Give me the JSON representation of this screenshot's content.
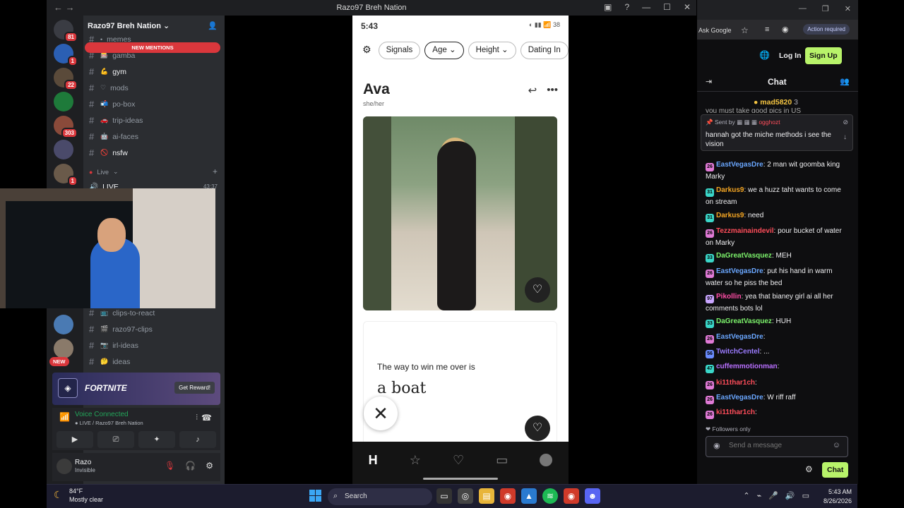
{
  "discord": {
    "window_title": "Razo97 Breh Nation",
    "server_name": "Razo97 Breh Nation",
    "new_mentions": "NEW MENTIONS",
    "badges": [
      "81",
      "1",
      "22",
      "303",
      "1",
      "NEW"
    ],
    "channels": [
      {
        "name": "memes",
        "emoji": "•",
        "bold": false
      },
      {
        "name": "gamba",
        "emoji": "🎰",
        "bold": false
      },
      {
        "name": "gym",
        "emoji": "💪",
        "bold": true
      },
      {
        "name": "mods",
        "emoji": "♡",
        "bold": false
      },
      {
        "name": "po-box",
        "emoji": "📬",
        "bold": false
      },
      {
        "name": "trip-ideas",
        "emoji": "🚗",
        "bold": false
      },
      {
        "name": "ai-faces",
        "emoji": "🤖",
        "bold": false
      },
      {
        "name": "nsfw",
        "emoji": "🚫",
        "bold": true
      }
    ],
    "live_category": "Live",
    "live_channel": "LIVE",
    "live_time": "43:37",
    "channels_lower": [
      {
        "name": "clips-to-react",
        "emoji": "📺"
      },
      {
        "name": "razo97-clips",
        "emoji": "🎬"
      },
      {
        "name": "irl-ideas",
        "emoji": "📷"
      },
      {
        "name": "ideas",
        "emoji": "🤔"
      }
    ],
    "promo": {
      "name": "FORTNITE",
      "button": "Get Reward!"
    },
    "voice": {
      "status": "Voice Connected",
      "channel": "LIVE / Razo97 Breh Nation"
    },
    "user": {
      "name": "Razo",
      "status": "Invisible"
    }
  },
  "phone": {
    "time": "5:43",
    "battery": "38",
    "filters": [
      "Signals",
      "Age",
      "Height",
      "Dating In"
    ],
    "profile_name": "Ava",
    "pronouns": "she/her",
    "prompt_question": "The way to win me over is",
    "prompt_answer": "a boat"
  },
  "browser": {
    "ask_google": "Ask Google",
    "action_required": "Action required",
    "login": "Log In",
    "signup": "Sign Up",
    "chat_title": "Chat",
    "pinned_sender": "ogghozt",
    "pinned_label": "Sent by",
    "pinned_text": "hannah got the miche methods i see the vision",
    "top_user": "mad5820",
    "top_user_count": "3",
    "top_cut_text": "you must take good pics in US",
    "messages": [
      {
        "badge": "26",
        "badgecolor": "#e07ad6",
        "user": "EastVegasDre",
        "color": "#6aa7ff",
        "text": ": 2 man wit goomba king Marky"
      },
      {
        "badge": "31",
        "badgecolor": "#3ad6c8",
        "user": "Darkus9",
        "color": "#f5a623",
        "text": ": we a huzz taht wants to come on stream"
      },
      {
        "badge": "31",
        "badgecolor": "#3ad6c8",
        "user": "Darkus9",
        "color": "#f5a623",
        "text": ": need"
      },
      {
        "badge": "26",
        "badgecolor": "#e07ad6",
        "user": "Tezzmainaindevil",
        "color": "#ff4d5a",
        "text": ": pour bucket of water on Marky"
      },
      {
        "badge": "33",
        "badgecolor": "#3ad6c8",
        "user": "DaGreatVasquez",
        "color": "#7cf26b",
        "text": ": MEH"
      },
      {
        "badge": "26",
        "badgecolor": "#e07ad6",
        "user": "EastVegasDre",
        "color": "#6aa7ff",
        "text": ": put his hand in warm water so he piss the bed"
      },
      {
        "badge": "97",
        "badgecolor": "#c9a6ff",
        "user": "Pikollin",
        "color": "#ff4da6",
        "text": ": yea that bianey girl ai all her comments bots lol"
      },
      {
        "badge": "33",
        "badgecolor": "#3ad6c8",
        "user": "DaGreatVasquez",
        "color": "#7cf26b",
        "text": ": HUH"
      },
      {
        "badge": "26",
        "badgecolor": "#e07ad6",
        "user": "EastVegasDre",
        "color": "#6aa7ff",
        "text": ":"
      },
      {
        "badge": "56",
        "badgecolor": "#6a8cff",
        "user": "TwitchCentel",
        "color": "#9b7bff",
        "text": ": ..."
      },
      {
        "badge": "47",
        "badgecolor": "#3ad6c8",
        "user": "cuffemmotionman",
        "color": "#b970ff",
        "text": ":"
      },
      {
        "badge": "26",
        "badgecolor": "#e07ad6",
        "user": "ki11thar1ch",
        "color": "#ff4d5a",
        "text": ":"
      },
      {
        "badge": "26",
        "badgecolor": "#e07ad6",
        "user": "EastVegasDre",
        "color": "#6aa7ff",
        "text": ": W riff raff"
      },
      {
        "badge": "26",
        "badgecolor": "#e07ad6",
        "user": "ki11thar1ch",
        "color": "#ff4d5a",
        "text": ":"
      }
    ],
    "followers_only": "Followers only",
    "send_placeholder": "Send a message",
    "chat_button": "Chat"
  },
  "taskbar": {
    "temp": "84°F",
    "weather": "Mostly clear",
    "search": "Search",
    "time": "5:43 AM",
    "date": "8/26/2026"
  }
}
